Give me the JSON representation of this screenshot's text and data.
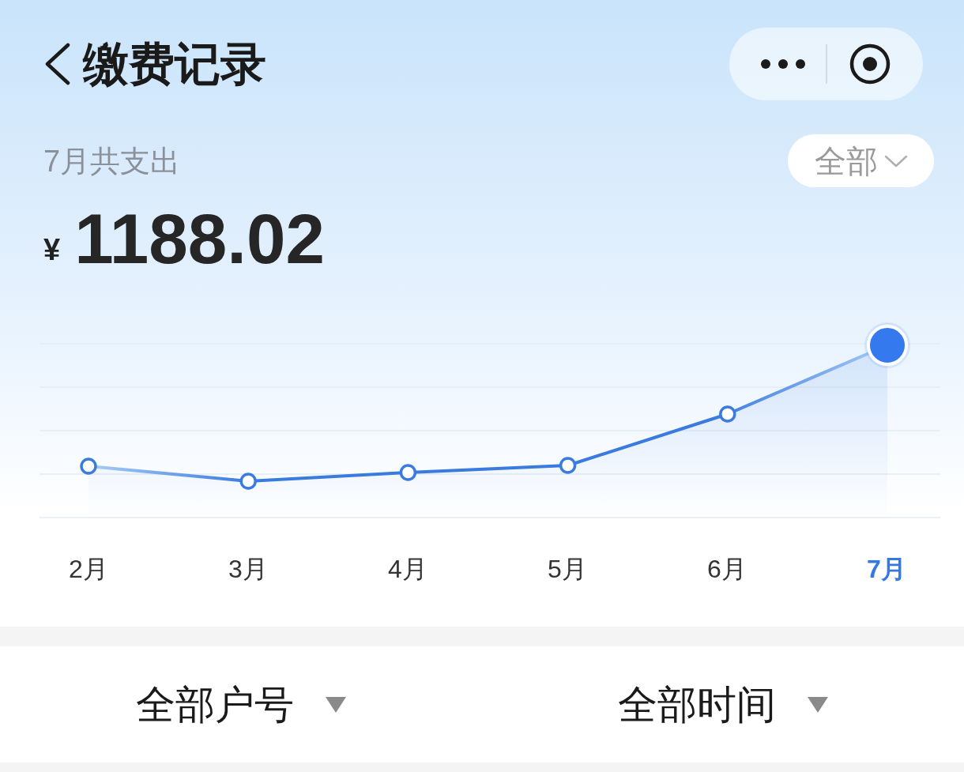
{
  "header": {
    "title": "缴费记录"
  },
  "summary": {
    "label": "7月共支出",
    "currency": "¥",
    "amount": "1188.02",
    "range_filter": {
      "label": "全部"
    }
  },
  "chart": {
    "months": [
      {
        "label": "2月",
        "selected": false
      },
      {
        "label": "3月",
        "selected": false
      },
      {
        "label": "4月",
        "selected": false
      },
      {
        "label": "5月",
        "selected": false
      },
      {
        "label": "6月",
        "selected": false
      },
      {
        "label": "7月",
        "selected": true
      }
    ]
  },
  "filters": [
    {
      "label": "全部户号"
    },
    {
      "label": "全部时间"
    }
  ]
}
